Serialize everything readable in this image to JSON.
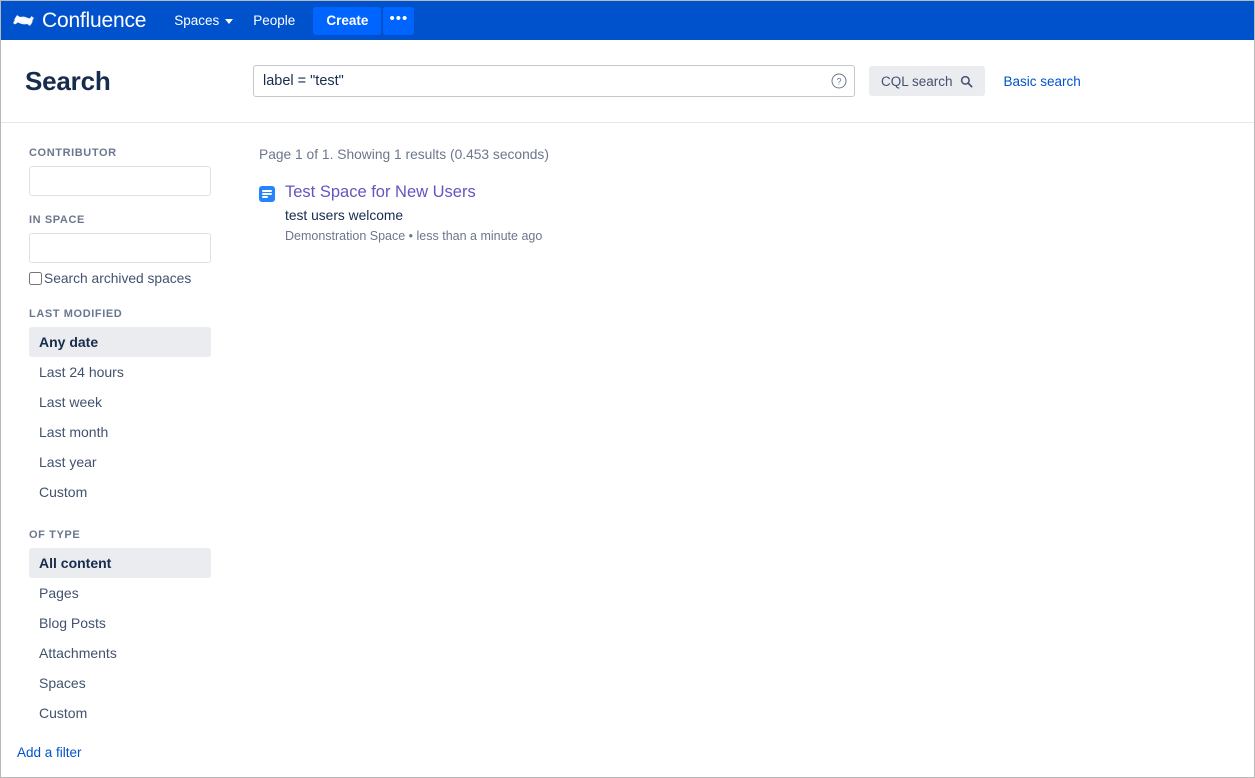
{
  "navbar": {
    "brand": "Confluence",
    "logo_icon": "confluence-logo-icon",
    "items": [
      {
        "label": "Spaces",
        "has_caret": true
      },
      {
        "label": "People",
        "has_caret": false
      }
    ],
    "create_label": "Create",
    "more_label": "•••",
    "background_color": "#0052CC",
    "button_color": "#0065FF"
  },
  "header": {
    "title": "Search",
    "query_value": "label = \"test\"",
    "query_placeholder": "",
    "help_icon": "question-circle-icon",
    "cql_button_label": "CQL search",
    "cql_button_icon": "search-icon",
    "basic_search_label": "Basic search",
    "link_color": "#0052CC"
  },
  "sidebar": {
    "contributor": {
      "label": "CONTRIBUTOR",
      "value": "",
      "placeholder": ""
    },
    "in_space": {
      "label": "IN SPACE",
      "value": "",
      "placeholder": ""
    },
    "archived_checkbox": {
      "label": "Search archived spaces",
      "checked": false
    },
    "last_modified": {
      "label": "LAST MODIFIED",
      "options": [
        {
          "label": "Any date",
          "selected": true
        },
        {
          "label": "Last 24 hours",
          "selected": false
        },
        {
          "label": "Last week",
          "selected": false
        },
        {
          "label": "Last month",
          "selected": false
        },
        {
          "label": "Last year",
          "selected": false
        },
        {
          "label": "Custom",
          "selected": false
        }
      ]
    },
    "of_type": {
      "label": "OF TYPE",
      "options": [
        {
          "label": "All content",
          "selected": true
        },
        {
          "label": "Pages",
          "selected": false
        },
        {
          "label": "Blog Posts",
          "selected": false
        },
        {
          "label": "Attachments",
          "selected": false
        },
        {
          "label": "Spaces",
          "selected": false
        },
        {
          "label": "Custom",
          "selected": false
        }
      ]
    },
    "add_filter_label": "Add a filter",
    "selected_background": "#EBECF0"
  },
  "results": {
    "meta": "Page 1 of 1. Showing 1 results (0.453 seconds)",
    "items": [
      {
        "icon": "page-icon",
        "title": "Test Space for New Users",
        "snippet": "test users welcome",
        "source": "Demonstration Space • less than a minute ago",
        "title_color": "#6554C0"
      }
    ]
  }
}
